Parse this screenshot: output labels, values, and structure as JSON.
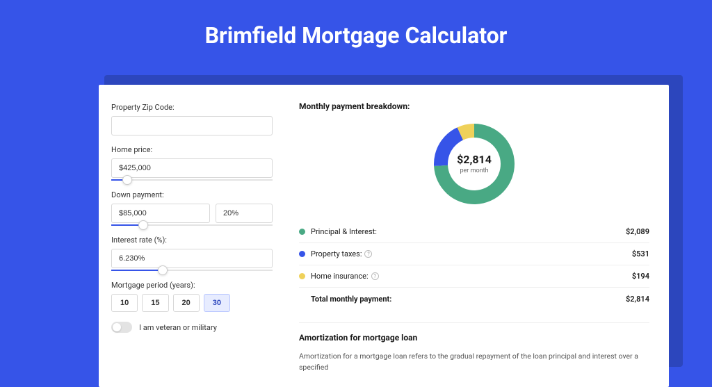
{
  "title": "Brimfield Mortgage Calculator",
  "form": {
    "zip": {
      "label": "Property Zip Code:",
      "value": ""
    },
    "price": {
      "label": "Home price:",
      "value": "$425,000",
      "slider_pct": 10
    },
    "down": {
      "label": "Down payment:",
      "amount": "$85,000",
      "pct": "20%",
      "slider_pct": 20
    },
    "rate": {
      "label": "Interest rate (%):",
      "value": "6.230%",
      "slider_pct": 32
    },
    "period": {
      "label": "Mortgage period (years):",
      "options": [
        "10",
        "15",
        "20",
        "30"
      ],
      "selected": "30"
    },
    "veteran": {
      "label": "I am veteran or military",
      "checked": false
    }
  },
  "breakdown": {
    "title": "Monthly payment breakdown:",
    "center_value": "$2,814",
    "center_sub": "per month",
    "items": [
      {
        "label": "Principal & Interest:",
        "value": "$2,089",
        "color": "#49a984",
        "pct": 74.2,
        "info": false
      },
      {
        "label": "Property taxes:",
        "value": "$531",
        "color": "#3654e8",
        "pct": 18.9,
        "info": true
      },
      {
        "label": "Home insurance:",
        "value": "$194",
        "color": "#efd15a",
        "pct": 6.9,
        "info": true
      }
    ],
    "total": {
      "label": "Total monthly payment:",
      "value": "$2,814"
    }
  },
  "amort": {
    "title": "Amortization for mortgage loan",
    "text": "Amortization for a mortgage loan refers to the gradual repayment of the loan principal and interest over a specified"
  },
  "chart_data": {
    "type": "pie",
    "title": "Monthly payment breakdown",
    "series": [
      {
        "name": "Principal & Interest",
        "value": 2089,
        "color": "#49a984"
      },
      {
        "name": "Property taxes",
        "value": 531,
        "color": "#3654e8"
      },
      {
        "name": "Home insurance",
        "value": 194,
        "color": "#efd15a"
      }
    ],
    "total": 2814,
    "center_label": "$2,814 per month"
  }
}
